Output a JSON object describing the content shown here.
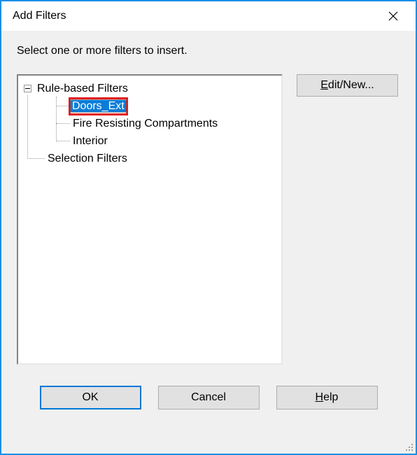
{
  "title": "Add Filters",
  "instruction": "Select one or more filters to insert.",
  "tree": {
    "rule_filters_label": "Rule-based Filters",
    "selection_filters_label": "Selection Filters",
    "children": {
      "doors_ext": "Doors_Ext",
      "fire_resisting": "Fire Resisting Compartments",
      "interior": "Interior"
    },
    "selected": "doors_ext"
  },
  "buttons": {
    "edit_new": "Edit/New...",
    "edit_new_underline": "E",
    "ok": "OK",
    "cancel": "Cancel",
    "help": "Help",
    "help_underline": "H"
  }
}
